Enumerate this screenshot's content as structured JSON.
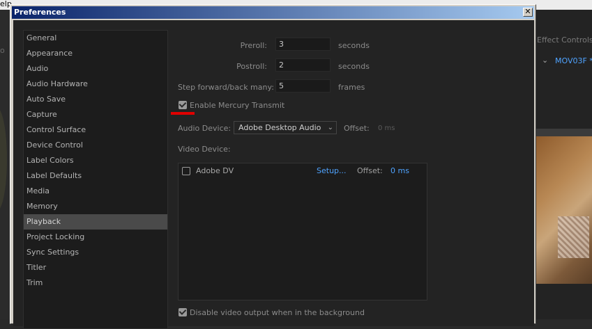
{
  "background_app": {
    "menu_fragment": "elp",
    "left_fragment": "o",
    "effect_controls_label": "Effect Controls",
    "sequence_label": "MOV03F *"
  },
  "dialog": {
    "title": "Preferences",
    "close_glyph": "✕"
  },
  "categories": [
    "General",
    "Appearance",
    "Audio",
    "Audio Hardware",
    "Auto Save",
    "Capture",
    "Control Surface",
    "Device Control",
    "Label Colors",
    "Label Defaults",
    "Media",
    "Memory",
    "Playback",
    "Project Locking",
    "Sync Settings",
    "Titler",
    "Trim"
  ],
  "selected_category": "Playback",
  "playback": {
    "preroll": {
      "label": "Preroll:",
      "value": "3",
      "unit": "seconds"
    },
    "postroll": {
      "label": "Postroll:",
      "value": "2",
      "unit": "seconds"
    },
    "step": {
      "label": "Step forward/back many:",
      "value": "5",
      "unit": "frames"
    },
    "mercury_transmit": {
      "label": "Enable Mercury Transmit",
      "checked": true
    },
    "audio_device": {
      "label": "Audio Device:",
      "value": "Adobe Desktop Audio",
      "offset_label": "Offset:",
      "offset_value": "0 ms"
    },
    "video_device": {
      "label": "Video Device:",
      "devices": [
        {
          "name": "Adobe DV",
          "checked": false,
          "setup_label": "Setup...",
          "offset_label": "Offset:",
          "offset_value": "0 ms"
        }
      ]
    },
    "disable_background": {
      "label": "Disable video output when in the background",
      "checked": true
    }
  },
  "colors": {
    "accent_link": "#4fa3ff",
    "annotation_red": "#e00000",
    "titlebar_start": "#0a246a",
    "titlebar_end": "#a6caf0"
  }
}
